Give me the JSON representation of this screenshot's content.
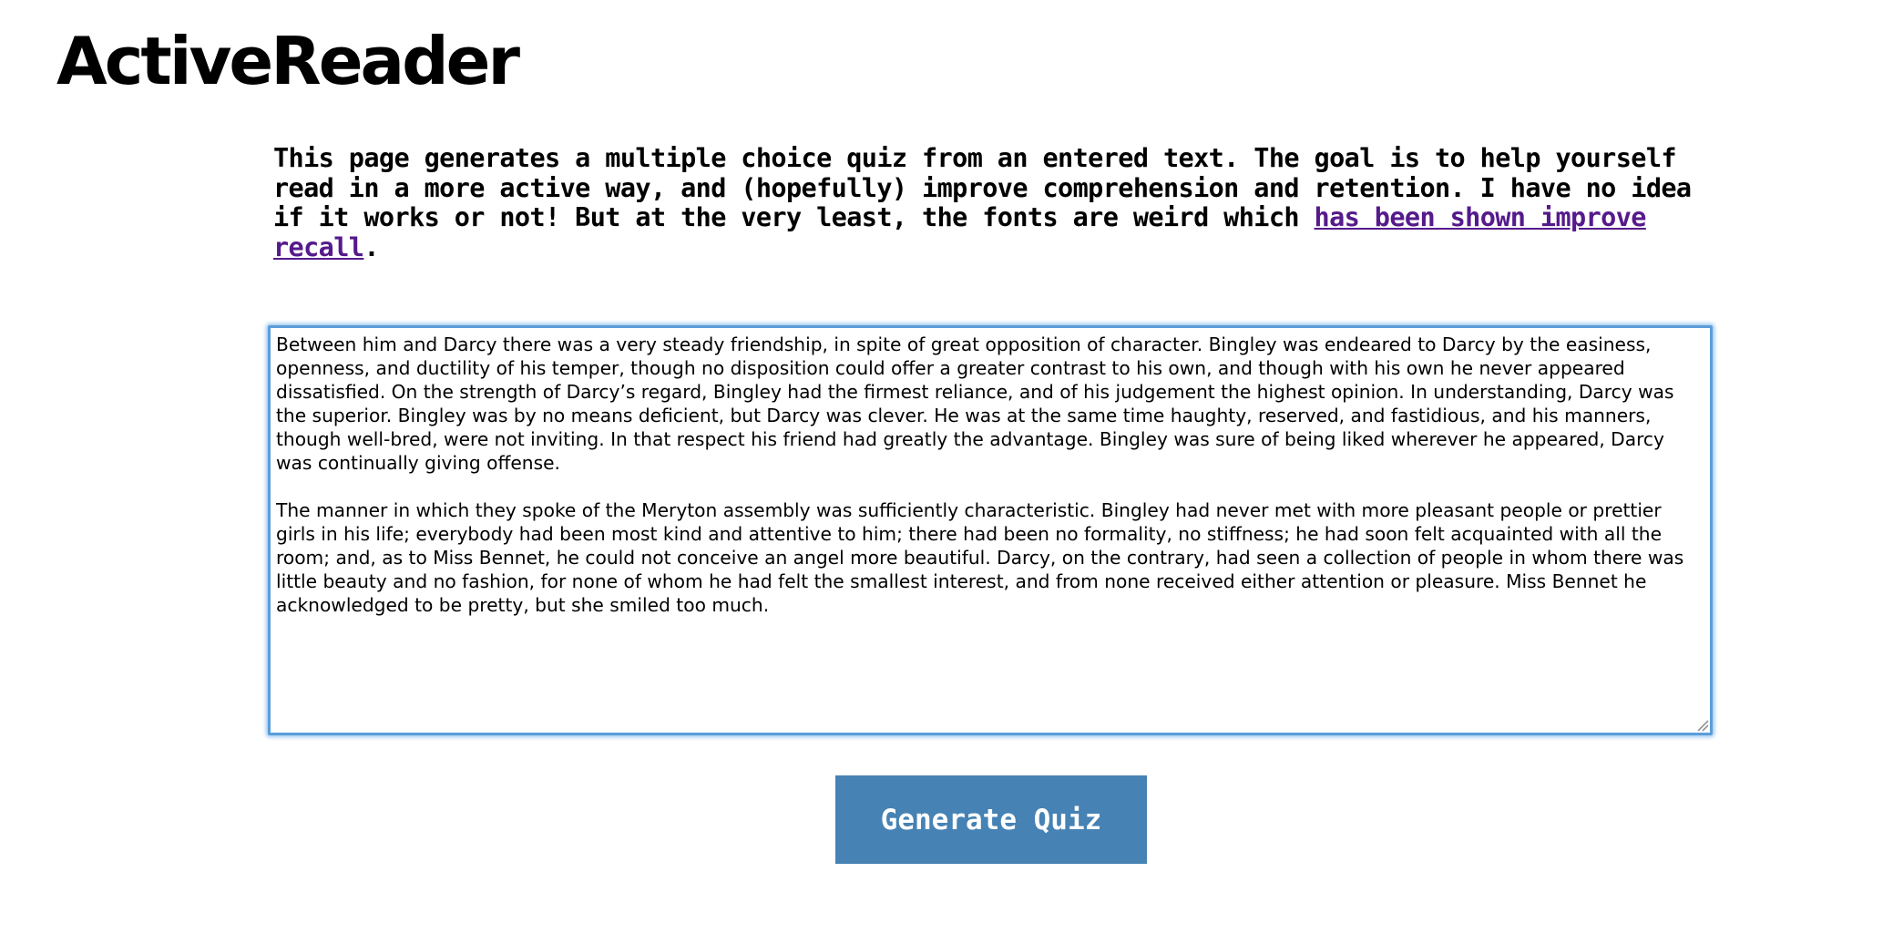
{
  "app": {
    "title": "ActiveReader"
  },
  "intro": {
    "text": "This page generates a multiple choice quiz from an entered text. The goal is to help yourself read in a more active way, and (hopefully) improve comprehension and retention. I have no idea if it works or not! But at the very least, the fonts are weird which ",
    "link_text": "has been shown improve recall",
    "trailing": "."
  },
  "input": {
    "value": "Between him and Darcy there was a very steady friendship, in spite of great opposition of character. Bingley was endeared to Darcy by the easiness, openness, and ductility of his temper, though no disposition could offer a greater contrast to his own, and though with his own he never appeared dissatisfied. On the strength of Darcy’s regard, Bingley had the firmest reliance, and of his judgement the highest opinion. In understanding, Darcy was the superior. Bingley was by no means deficient, but Darcy was clever. He was at the same time haughty, reserved, and fastidious, and his manners, though well-bred, were not inviting. In that respect his friend had greatly the advantage. Bingley was sure of being liked wherever he appeared, Darcy was continually giving offense.\n\nThe manner in which they spoke of the Meryton assembly was sufficiently characteristic. Bingley had never met with more pleasant people or prettier girls in his life; everybody had been most kind and attentive to him; there had been no formality, no stiffness; he had soon felt acquainted with all the room; and, as to Miss Bennet, he could not conceive an angel more beautiful. Darcy, on the contrary, had seen a collection of people in whom there was little beauty and no fashion, for none of whom he had felt the smallest interest, and from none received either attention or pleasure. Miss Bennet he acknowledged to be pretty, but she smiled too much."
  },
  "actions": {
    "generate_label": "Generate Quiz"
  },
  "colors": {
    "button_bg": "#4682b4",
    "link": "#551a8b",
    "focus_border": "#5b9dd9"
  }
}
